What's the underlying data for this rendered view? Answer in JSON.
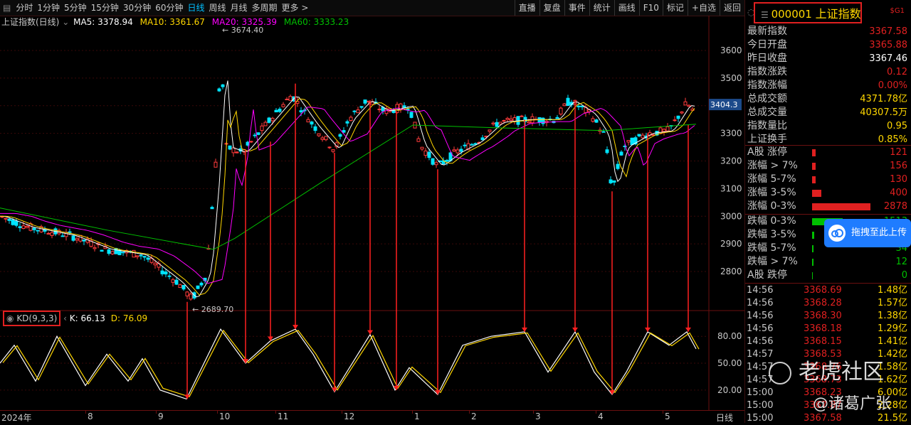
{
  "toolbar": {
    "periods": [
      "分时",
      "1分钟",
      "5分钟",
      "15分钟",
      "30分钟",
      "60分钟",
      "日线",
      "周线",
      "月线",
      "多周期",
      "更多 >"
    ],
    "active_index": 6,
    "right_buttons": [
      "直播",
      "复盘",
      "事件",
      "统计",
      "画线",
      "F10",
      "标记",
      "+自选",
      "返回"
    ]
  },
  "chart": {
    "title": "上证指数(日线)",
    "ma5": "MA5: 3378.94",
    "ma10": "MA10: 3361.67",
    "ma20": "MA20: 3325.39",
    "ma60": "MA60: 3333.23",
    "ma_colors": {
      "ma5": "#ffffff",
      "ma10": "#ffd700",
      "ma20": "#ff00ff",
      "ma60": "#00c000"
    },
    "price_ticks": [
      "3600",
      "3500",
      "3400",
      "3300",
      "3200",
      "3100",
      "3000",
      "2900",
      "2800"
    ],
    "current_price_tag": "3404.3",
    "high_label": "3674.40",
    "low_label": "2689.70",
    "kd_name": "KD(9,3,3)",
    "kd_k": "K: 66.13",
    "kd_d": "D: 76.09",
    "kd_ticks": [
      "80.00",
      "50.00",
      "20.00"
    ],
    "x_labels": [
      "2024年",
      "8",
      "9",
      "10",
      "11",
      "12",
      "1",
      "2",
      "3",
      "4",
      "5"
    ],
    "period_label": "日线"
  },
  "chart_data": {
    "type": "line",
    "title": "上证指数(日线)",
    "x": [
      "2024年",
      "8",
      "9",
      "10",
      "11",
      "12",
      "1",
      "2",
      "3",
      "4",
      "5"
    ],
    "series": [
      {
        "name": "MA5",
        "values": [
          2960,
          2900,
          2740,
          3320,
          3360,
          3380,
          3250,
          3300,
          3350,
          3200,
          3380
        ]
      },
      {
        "name": "MA10",
        "values": [
          2965,
          2910,
          2760,
          3280,
          3350,
          3380,
          3270,
          3290,
          3340,
          3220,
          3362
        ]
      },
      {
        "name": "MA20",
        "values": [
          2970,
          2920,
          2790,
          3200,
          3340,
          3370,
          3280,
          3280,
          3330,
          3250,
          3325
        ]
      },
      {
        "name": "MA60",
        "values": [
          3050,
          2970,
          2870,
          3000,
          3180,
          3330,
          3330,
          3310,
          3310,
          3290,
          3333
        ]
      }
    ],
    "ylim": [
      2650,
      3700
    ],
    "kd": {
      "name": "KD(9,3,3)",
      "k": 66.13,
      "d": 76.09,
      "ylim": [
        0,
        100
      ]
    }
  },
  "quote": {
    "code": "000001",
    "name": "上证指数",
    "sg": "$G1",
    "rows": [
      {
        "k": "最新指数",
        "v": "3367.58",
        "c": "#e02020"
      },
      {
        "k": "今日开盘",
        "v": "3365.88",
        "c": "#e02020"
      },
      {
        "k": "昨日收盘",
        "v": "3367.46",
        "c": "#ffffff"
      },
      {
        "k": "指数涨跌",
        "v": "0.12",
        "c": "#e02020"
      },
      {
        "k": "指数涨幅",
        "v": "0.00%",
        "c": "#e02020"
      },
      {
        "k": "总成交额",
        "v": "4371.78亿",
        "c": "#ffd700"
      },
      {
        "k": "总成交量",
        "v": "40307.5万",
        "c": "#ffd700"
      },
      {
        "k": "指数量比",
        "v": "0.95",
        "c": "#ffd700"
      },
      {
        "k": "上证换手",
        "v": "0.85%",
        "c": "#ffd700"
      }
    ],
    "breadth": [
      {
        "k": "A股 涨停",
        "v": "121",
        "c": "#e02020",
        "bar": 5
      },
      {
        "k": "涨幅 > 7%",
        "v": "156",
        "c": "#e02020",
        "bar": 5
      },
      {
        "k": "涨幅 5-7%",
        "v": "130",
        "c": "#e02020",
        "bar": 5
      },
      {
        "k": "涨幅 3-5%",
        "v": "400",
        "c": "#e02020",
        "bar": 13
      },
      {
        "k": "涨幅 0-3%",
        "v": "2878",
        "c": "#e02020",
        "bar": 82
      }
    ],
    "breadth_down": [
      {
        "k": "跌幅 0-3%",
        "v": "1513",
        "c": "#00c000",
        "bar": 43
      },
      {
        "k": "跌幅 3-5%",
        "v": "91",
        "c": "#00c000",
        "bar": 3
      },
      {
        "k": "跌幅 5-7%",
        "v": "34",
        "c": "#00c000",
        "bar": 1
      },
      {
        "k": "跌幅 > 7%",
        "v": "12",
        "c": "#00c000",
        "bar": 1
      },
      {
        "k": "A股 跌停",
        "v": "0",
        "c": "#00c000",
        "bar": 0
      }
    ],
    "ticks": [
      {
        "t": "14:56",
        "p": "3368.69",
        "v": "1.48亿"
      },
      {
        "t": "14:56",
        "p": "3368.28",
        "v": "1.57亿"
      },
      {
        "t": "14:56",
        "p": "3368.30",
        "v": "1.38亿"
      },
      {
        "t": "14:56",
        "p": "3368.18",
        "v": "1.29亿"
      },
      {
        "t": "14:56",
        "p": "3368.15",
        "v": "1.41亿"
      },
      {
        "t": "14:57",
        "p": "3368.53",
        "v": "1.42亿"
      },
      {
        "t": "14:57",
        "p": "3368.76",
        "v": "1.58亿"
      },
      {
        "t": "14:57",
        "p": "3368.73",
        "v": "1.62亿"
      },
      {
        "t": "15:00",
        "p": "3368.23",
        "v": "6.00亿"
      },
      {
        "t": "15:00",
        "p": "3367.87",
        "v": "2.28亿"
      },
      {
        "t": "15:00",
        "p": "3367.58",
        "v": "21.5亿"
      }
    ]
  },
  "overlays": {
    "upload_label": "拖拽至此上传",
    "watermark1": "老虎社区",
    "watermark2": "@诸葛广张"
  }
}
